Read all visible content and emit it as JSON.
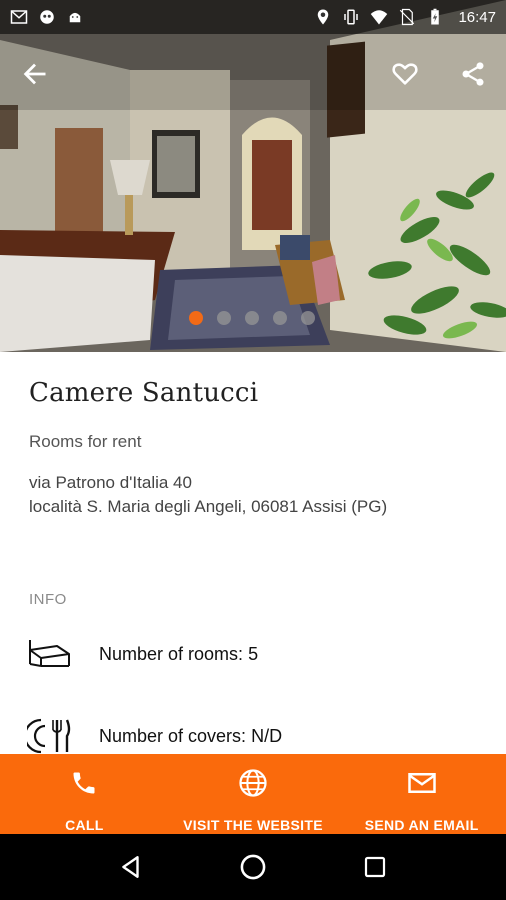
{
  "status_bar": {
    "time": "16:47",
    "icons_left": [
      "gmail-icon",
      "game-controller-icon",
      "android-icon"
    ],
    "icons_right": [
      "location-icon",
      "vibrate-icon",
      "wifi-icon",
      "no-sim-icon",
      "battery-charging-icon"
    ]
  },
  "app_bar": {
    "icons": [
      "back-arrow-icon",
      "favorite-heart-icon",
      "share-icon"
    ]
  },
  "gallery": {
    "image_count": 5,
    "active_index": 0,
    "accent_color": "#f26a16"
  },
  "place": {
    "name": "Camere Santucci",
    "category": "Rooms for rent",
    "address_line1": "via Patrono d'Italia 40",
    "address_line2": "località S. Maria degli Angeli, 06081 Assisi (PG)"
  },
  "info": {
    "header": "INFO",
    "rooms_label": "Number of rooms:",
    "rooms_value": "5",
    "covers_label": "Number of covers:",
    "covers_value": "N/D"
  },
  "actions": {
    "call": "CALL",
    "website": "VISIT THE WEBSITE",
    "email": "SEND AN EMAIL",
    "bar_color": "#fa6a0c"
  },
  "nav_bar": {
    "icons": [
      "back-triangle-icon",
      "home-circle-icon",
      "recents-square-icon"
    ]
  }
}
